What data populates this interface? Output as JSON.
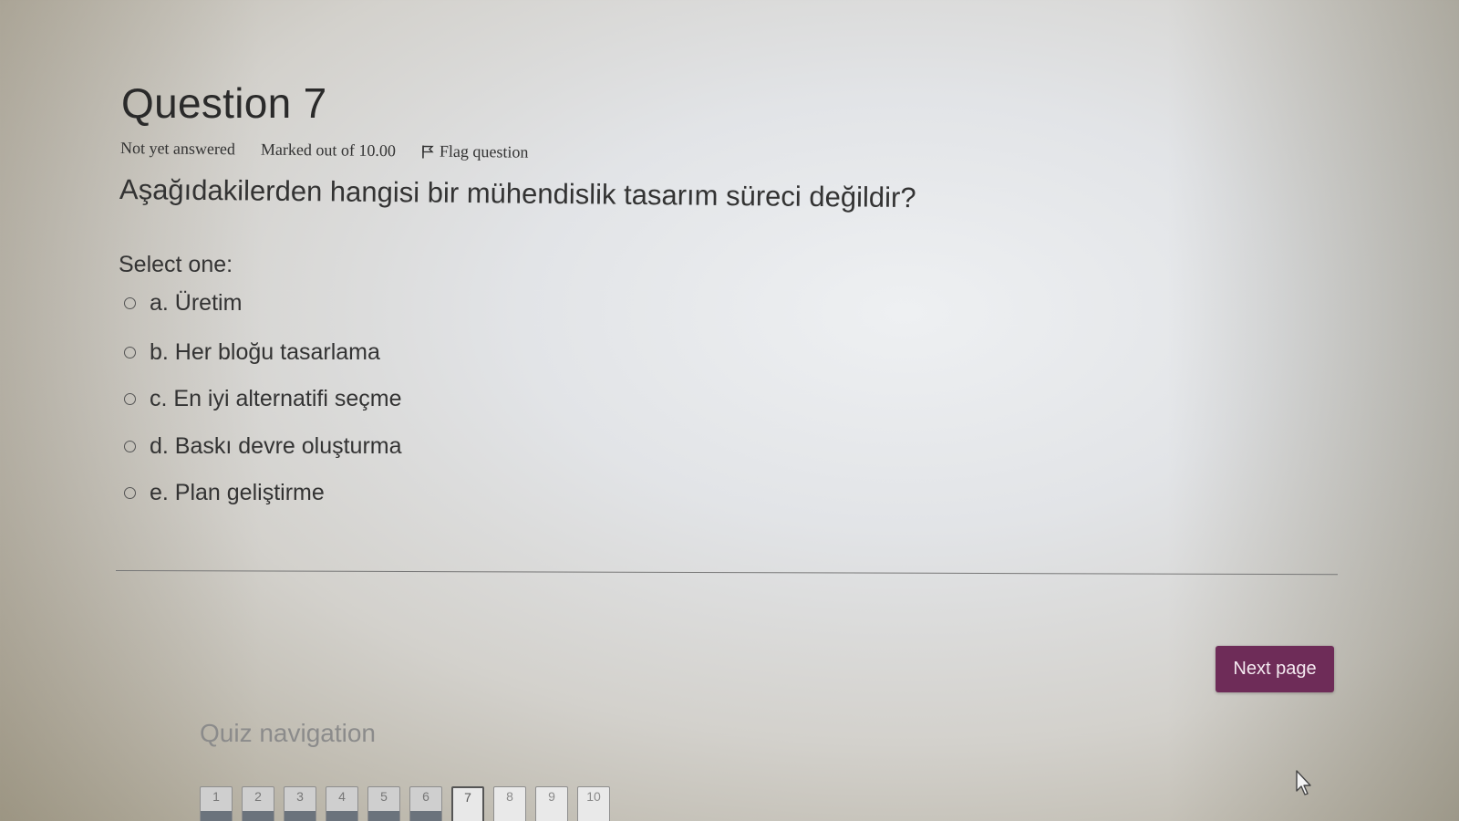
{
  "question": {
    "title": "Question 7",
    "status": "Not yet answered",
    "marks": "Marked out of 10.00",
    "flag_label": "Flag question",
    "text": "Aşağıdakilerden hangisi bir mühendislik tasarım süreci değildir?",
    "select_label": "Select one:",
    "options": [
      {
        "label": "a. Üretim",
        "selected": false
      },
      {
        "label": "b. Her bloğu tasarlama",
        "selected": false
      },
      {
        "label": "c. En iyi alternatifi seçme",
        "selected": false
      },
      {
        "label": "d. Baskı devre oluşturma",
        "selected": false
      },
      {
        "label": "e. Plan geliştirme",
        "selected": false
      }
    ]
  },
  "next_button": {
    "label": "Next page",
    "color": "#6e2c58"
  },
  "quiz_navigation": {
    "title": "Quiz navigation",
    "pages": [
      {
        "label": "1",
        "state": "answered"
      },
      {
        "label": "2",
        "state": "answered"
      },
      {
        "label": "3",
        "state": "answered"
      },
      {
        "label": "4",
        "state": "answered"
      },
      {
        "label": "5",
        "state": "answered"
      },
      {
        "label": "6",
        "state": "answered"
      },
      {
        "label": "7",
        "state": "current"
      },
      {
        "label": "8",
        "state": "open"
      },
      {
        "label": "9",
        "state": "open"
      },
      {
        "label": "10",
        "state": "open"
      }
    ]
  }
}
